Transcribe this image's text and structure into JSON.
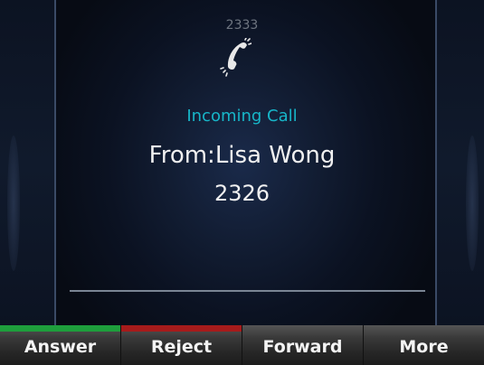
{
  "call": {
    "line_number": "2333",
    "status": "Incoming Call",
    "from": "From:Lisa Wong",
    "caller_number": "2326"
  },
  "softkeys": [
    {
      "label": "Answer",
      "indicator_color": "#1e9e3c"
    },
    {
      "label": "Reject",
      "indicator_color": "#a61b1b"
    },
    {
      "label": "Forward",
      "indicator_color": ""
    },
    {
      "label": "More",
      "indicator_color": ""
    }
  ],
  "colors": {
    "status_text": "#17b6c9",
    "background": "#0b1222"
  },
  "icons": {
    "call_icon": "ringing-handset-icon"
  }
}
